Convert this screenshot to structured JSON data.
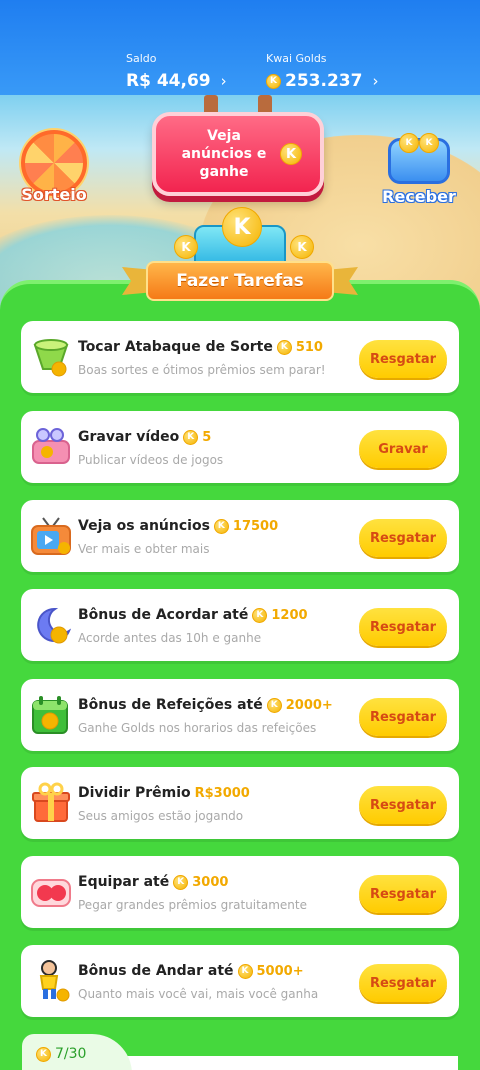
{
  "header": {
    "saldo_label": "Saldo",
    "saldo_value": "R$ 44,69",
    "golds_label": "Kwai Golds",
    "golds_value": "253.237",
    "chevron": "›"
  },
  "scene": {
    "sorteio_label": "Sorteio",
    "receber_label": "Receber",
    "ads_button_label": "Veja anúncios e ganhe",
    "coin_letter": "K"
  },
  "banner": {
    "title": "Fazer Tarefas"
  },
  "tasks": [
    {
      "title": "Tocar Atabaque de Sorte",
      "reward": "510",
      "subtitle": "Boas sortes e ótimos prêmios sem parar!",
      "button": "Resgatar",
      "icon": "drum-icon"
    },
    {
      "title": "Gravar vídeo",
      "reward": "5",
      "subtitle": "Publicar vídeos de jogos",
      "button": "Gravar",
      "icon": "video-record-icon"
    },
    {
      "title": "Veja os anúncios",
      "reward": "17500",
      "subtitle": "Ver mais e obter mais",
      "button": "Resgatar",
      "icon": "tv-icon"
    },
    {
      "title": "Bônus de Acordar até",
      "reward": "1200",
      "subtitle": "Acorde antes das 10h e ganhe",
      "button": "Resgatar",
      "icon": "moon-icon"
    },
    {
      "title": "Bônus de Refeições até",
      "reward": "2000+",
      "subtitle": "Ganhe Golds nos horarios das refeições",
      "button": "Resgatar",
      "icon": "calendar-icon"
    },
    {
      "title": "Dividir Prêmio",
      "reward": "R$3000",
      "subtitle": "Seus amigos estão jogando",
      "button": "Resgatar",
      "icon": "gift-icon"
    },
    {
      "title": "Equipar até",
      "reward": "3000",
      "subtitle": "Pegar grandes prêmios gratuitamente",
      "button": "Resgatar",
      "icon": "boxing-glove-icon"
    },
    {
      "title": "Bônus de Andar até",
      "reward": "5000+",
      "subtitle": "Quanto mais você vai, mais você ganha",
      "button": "Resgatar",
      "icon": "runner-icon"
    }
  ],
  "footer": {
    "progress": "7/30"
  },
  "colors": {
    "header_blue": "#1f7ef0",
    "board_green": "#45d83d",
    "button_yellow": "#ffcb00",
    "button_text": "#d64a14",
    "coin_gold": "#f5b400"
  }
}
